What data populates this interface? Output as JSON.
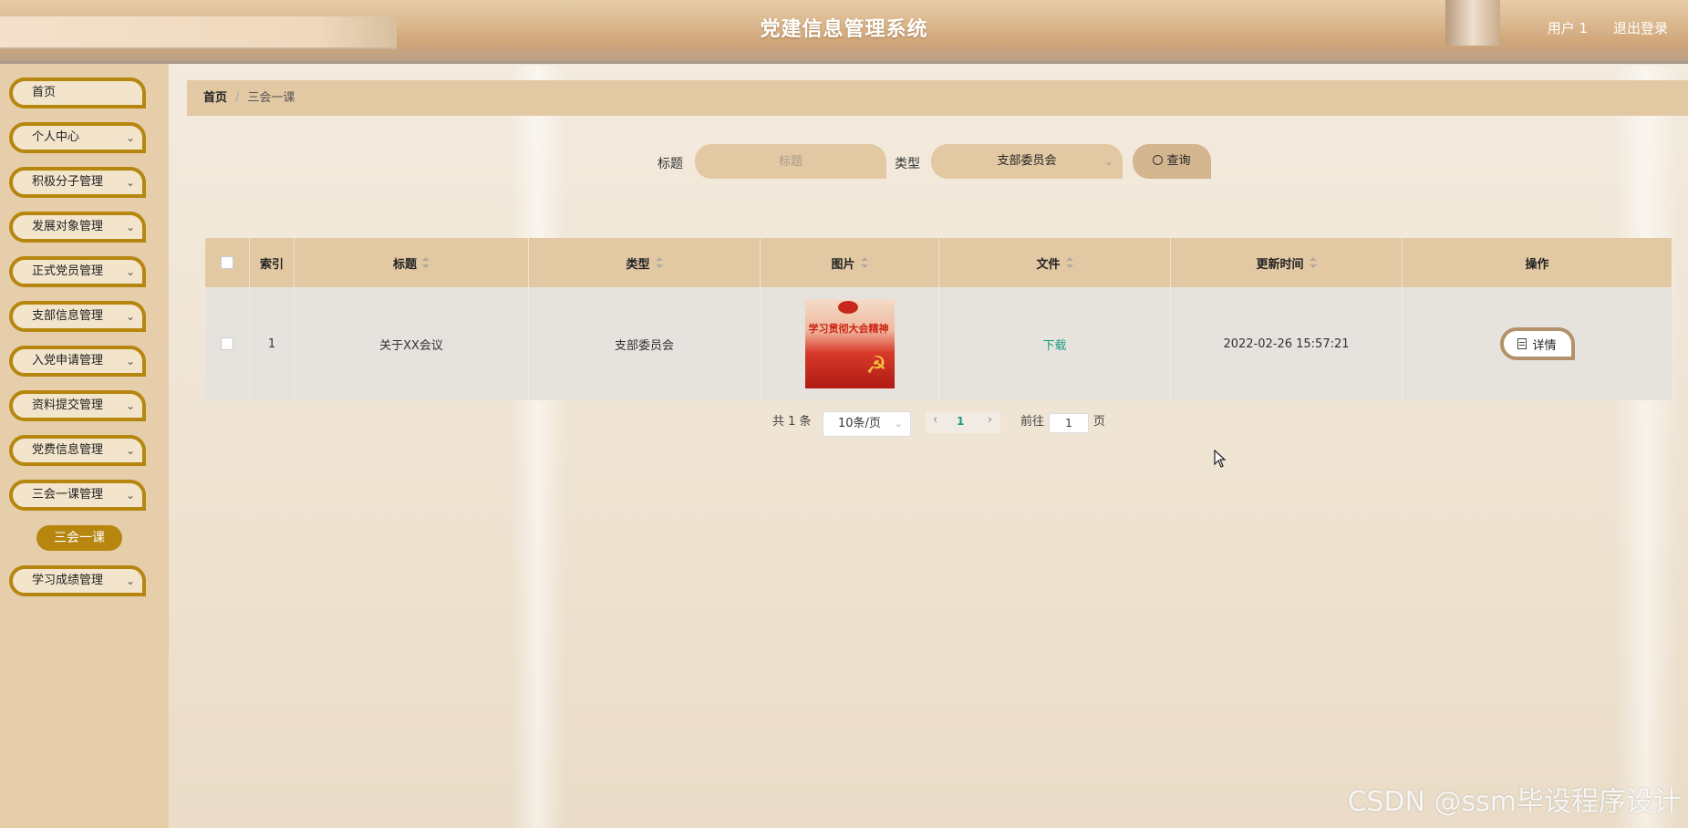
{
  "header": {
    "title": "党建信息管理系统",
    "user": "用户 1",
    "logout": "退出登录"
  },
  "sidebar": {
    "items": [
      {
        "label": "首页",
        "expandable": false
      },
      {
        "label": "个人中心",
        "expandable": true
      },
      {
        "label": "积极分子管理",
        "expandable": true
      },
      {
        "label": "发展对象管理",
        "expandable": true
      },
      {
        "label": "正式党员管理",
        "expandable": true
      },
      {
        "label": "支部信息管理",
        "expandable": true
      },
      {
        "label": "入党申请管理",
        "expandable": true
      },
      {
        "label": "资料提交管理",
        "expandable": true
      },
      {
        "label": "党费信息管理",
        "expandable": true
      },
      {
        "label": "三会一课管理",
        "expandable": true
      },
      {
        "label": "学习成绩管理",
        "expandable": true
      }
    ],
    "active_submenu": "三会一课",
    "chevron": "chevron-down-icon"
  },
  "breadcrumb": {
    "home": "首页",
    "separator": "/",
    "current": "三会一课"
  },
  "search": {
    "title_label": "标题",
    "title_placeholder": "标题",
    "type_label": "类型",
    "type_value": "支部委员会",
    "button_label": "查询",
    "button_icon": "search-icon"
  },
  "table": {
    "headers": {
      "index": "索引",
      "title": "标题",
      "type": "类型",
      "image": "图片",
      "file": "文件",
      "updated": "更新时间",
      "actions": "操作"
    },
    "rows": [
      {
        "index": "1",
        "title": "关于XX会议",
        "type": "支部委员会",
        "image_text": "学习贯彻大会精神",
        "file_link": "下载",
        "updated": "2022-02-26 15:57:21",
        "action": "详情"
      }
    ]
  },
  "pagination": {
    "total": "共 1 条",
    "page_size": "10条/页",
    "current_page": "1",
    "goto_label": "前往",
    "goto_value": "1",
    "page_suffix": "页"
  },
  "watermark": "CSDN @ssm毕设程序设计",
  "colors": {
    "accent": "#b6860f",
    "header_bg": "#d9b48a",
    "link": "#1c9b7e"
  }
}
